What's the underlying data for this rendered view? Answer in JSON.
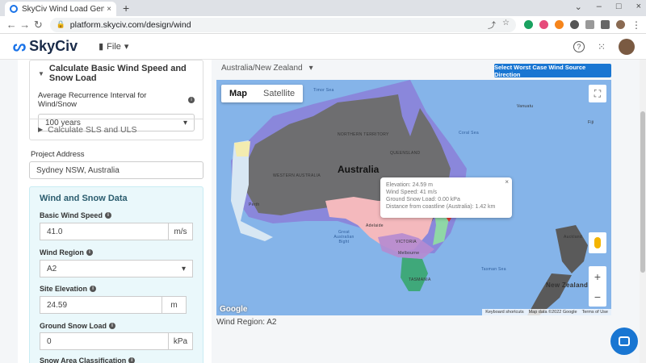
{
  "browser": {
    "tab_title": "SkyCiv Wind Load Genera",
    "tab_close": "×",
    "new_tab": "+",
    "url": "platform.skyciv.com/design/wind",
    "window_buttons": [
      "⌄",
      "–",
      "□",
      "×"
    ]
  },
  "app": {
    "logo": "SkyCiv",
    "file_menu": "File",
    "help": "?"
  },
  "left": {
    "basic_section": "Calculate Basic Wind Speed and Snow Load",
    "ari_label": "Average Recurrence Interval for Wind/Snow",
    "ari_value": "100 years",
    "sls_section": "Calculate SLS and ULS",
    "project_address_label": "Project Address",
    "project_address_value": "Sydney NSW, Australia",
    "wsd_title": "Wind and Snow Data",
    "basic_wind_speed_label": "Basic Wind Speed",
    "basic_wind_speed_value": "41.0",
    "basic_wind_speed_unit": "m/s",
    "wind_region_label": "Wind Region",
    "wind_region_value": "A2",
    "site_elevation_label": "Site Elevation",
    "site_elevation_value": "24.59",
    "site_elevation_unit": "m",
    "ground_snow_label": "Ground Snow Load",
    "ground_snow_value": "0",
    "ground_snow_unit": "kPa",
    "snow_area_label": "Snow Area Classification"
  },
  "map_panel": {
    "region_select": "Australia/New Zealand",
    "worst_case_button": "Select Worst Case Wind Source Direction",
    "map_tab": "Map",
    "satellite_tab": "Satellite",
    "country_label": "Australia",
    "labels": {
      "timor": "Timor Sea",
      "northern_territory": "NORTHERN TERRITORY",
      "queensland": "QUEENSLAND",
      "western_australia": "WESTERN AUSTRALIA",
      "coral_sea": "Coral Sea",
      "perth": "Perth",
      "adelaide": "Adelaide",
      "victoria": "VICTORIA",
      "melbourne": "Melbourne",
      "tasmania": "TASMANIA",
      "great_bight": "Great Australian Bight",
      "tasman_sea": "Tasman Sea",
      "auckland": "Auckland",
      "new_zealand": "New Zealand",
      "fiji": "Fiji",
      "vanuatu": "Vanuatu"
    },
    "info": {
      "elevation": "Elevation: 24.59 m",
      "wind_speed": "Wind Speed: 41 m/s",
      "ground_snow": "Ground Snow Load: 0.00 kPa",
      "distance": "Distance from coastline (Australia): 1.42 km",
      "close": "×"
    },
    "attribution": [
      "Keyboard shortcuts",
      "Map data ©2022 Google",
      "Terms of Use"
    ],
    "google": "Google",
    "wind_region_text": "Wind Region: A2"
  }
}
